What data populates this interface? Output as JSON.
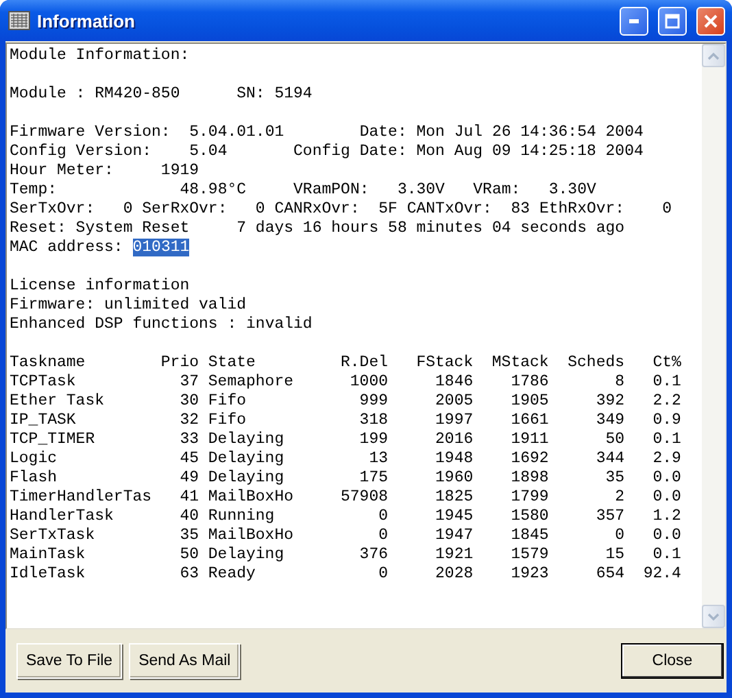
{
  "window": {
    "title": "Information"
  },
  "sections": [
    [
      {
        "text": "Module Information:"
      }
    ],
    [
      {
        "text": "Module : RM420-850      SN: 5194"
      }
    ],
    [
      {
        "text": "Firmware Version:  5.04.01.01        Date: Mon Jul 26 14:36:54 2004"
      },
      {
        "text": "Config Version:    5.04       Config Date: Mon Aug 09 14:25:18 2004"
      },
      {
        "text": "Hour Meter:     1919"
      },
      {
        "text": "Temp:             48.98°C     VRamPON:   3.30V   VRam:   3.30V"
      },
      {
        "text": "SerTxOvr:   0 SerRxOvr:   0 CANRxOvr:  5F CANTxOvr:  83 EthRxOvr:    0"
      },
      {
        "text": "Reset: System Reset     7 days 16 hours 58 minutes 04 seconds ago"
      },
      {
        "text": "MAC address:",
        "selection": "010311"
      }
    ],
    [
      {
        "text": "License information"
      },
      {
        "text": "Firmware: unlimited valid"
      },
      {
        "text": "Enhanced DSP functions : invalid"
      }
    ]
  ],
  "table": {
    "columns": [
      "Taskname",
      "Prio",
      "State",
      "R.Del",
      "FStack",
      "MStack",
      "Scheds",
      "Ct%"
    ],
    "rows": [
      [
        "TCPTask",
        "37",
        "Semaphore",
        "1000",
        "1846",
        "1786",
        "8",
        "0.1"
      ],
      [
        "Ether Task",
        "30",
        "Fifo",
        "999",
        "2005",
        "1905",
        "392",
        "2.2"
      ],
      [
        "IP_TASK",
        "32",
        "Fifo",
        "318",
        "1997",
        "1661",
        "349",
        "0.9"
      ],
      [
        "TCP_TIMER",
        "33",
        "Delaying",
        "199",
        "2016",
        "1911",
        "50",
        "0.1"
      ],
      [
        "Logic",
        "45",
        "Delaying",
        "13",
        "1948",
        "1692",
        "344",
        "2.9"
      ],
      [
        "Flash",
        "49",
        "Delaying",
        "175",
        "1960",
        "1898",
        "35",
        "0.0"
      ],
      [
        "TimerHandlerTas",
        "41",
        "MailBoxHo",
        "57908",
        "1825",
        "1799",
        "2",
        "0.0"
      ],
      [
        "HandlerTask",
        "40",
        "Running",
        "0",
        "1945",
        "1580",
        "357",
        "1.2"
      ],
      [
        "SerTxTask",
        "35",
        "MailBoxHo",
        "0",
        "1947",
        "1845",
        "0",
        "0.0"
      ],
      [
        "MainTask",
        "50",
        "Delaying",
        "376",
        "1921",
        "1579",
        "15",
        "0.1"
      ],
      [
        "IdleTask",
        "63",
        "Ready",
        "0",
        "2028",
        "1923",
        "654",
        "92.4"
      ]
    ]
  },
  "left_buttons": [
    {
      "label": "Save To File",
      "default": false
    },
    {
      "label": "Send As Mail",
      "default": false
    }
  ],
  "right_buttons": [
    {
      "label": "Close",
      "default": true
    }
  ]
}
